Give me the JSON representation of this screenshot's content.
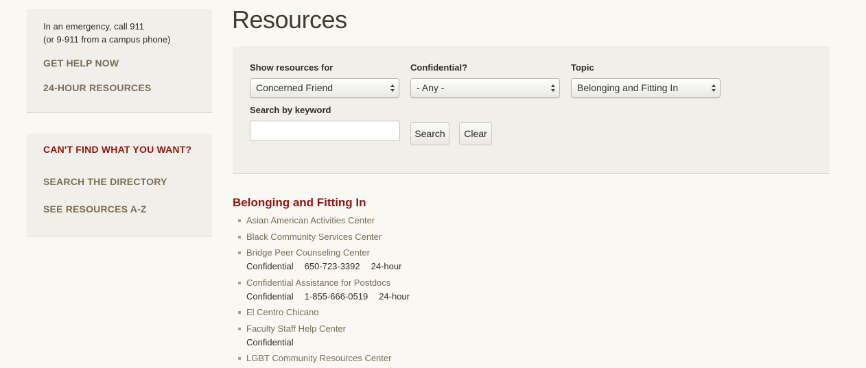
{
  "sidebar": {
    "emergency_line1": "In an emergency, call 911",
    "emergency_line2": "(or 9-911 from a campus phone)",
    "get_help_now": "GET HELP NOW",
    "resources_24h": "24-HOUR RESOURCES",
    "cant_find": "CAN'T FIND WHAT YOU WANT?",
    "search_directory": "SEARCH THE DIRECTORY",
    "resources_az": "SEE RESOURCES A-Z"
  },
  "main": {
    "title": "Resources",
    "filters": {
      "show_for_label": "Show resources for",
      "show_for_value": "Concerned Friend",
      "confidential_label": "Confidential?",
      "confidential_value": "- Any -",
      "topic_label": "Topic",
      "topic_value": "Belonging and Fitting In",
      "keyword_label": "Search by keyword",
      "keyword_value": "",
      "search_button": "Search",
      "clear_button": "Clear"
    },
    "results": {
      "heading": "Belonging and Fitting In",
      "items": [
        {
          "name": "Asian American Activities Center"
        },
        {
          "name": "Black Community Services Center"
        },
        {
          "name": "Bridge Peer Counseling Center",
          "confidential": "Confidential",
          "phone": "650-723-3392",
          "hours": "24-hour"
        },
        {
          "name": "Confidential Assistance for Postdocs",
          "confidential": "Confidential",
          "phone": "1-855-666-0519",
          "hours": "24-hour"
        },
        {
          "name": "El Centro Chicano"
        },
        {
          "name": "Faculty Staff Help Center",
          "confidential": "Confidential"
        },
        {
          "name": "LGBT Community Resources Center"
        }
      ]
    }
  },
  "colors": {
    "accent_red": "#8c1515",
    "link_olive": "#7a6e55",
    "panel_bg": "#f1efe9",
    "page_bg": "#f9f8f3"
  }
}
